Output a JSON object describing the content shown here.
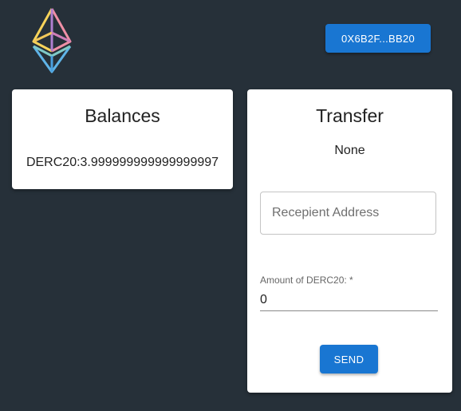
{
  "header": {
    "logo_icon": "ethereum-logo-icon",
    "wallet_address": "0X6B2F...BB20"
  },
  "balances": {
    "title": "Balances",
    "line": "DERC20:3.999999999999999997"
  },
  "transfer": {
    "title": "Transfer",
    "status": "None",
    "recipient_placeholder": "Recepient Address",
    "amount_label": "Amount of DERC20: *",
    "amount_value": "0",
    "send_label": "SEND"
  },
  "colors": {
    "background": "#263039",
    "accent": "#1976d2",
    "card": "#ffffff"
  }
}
